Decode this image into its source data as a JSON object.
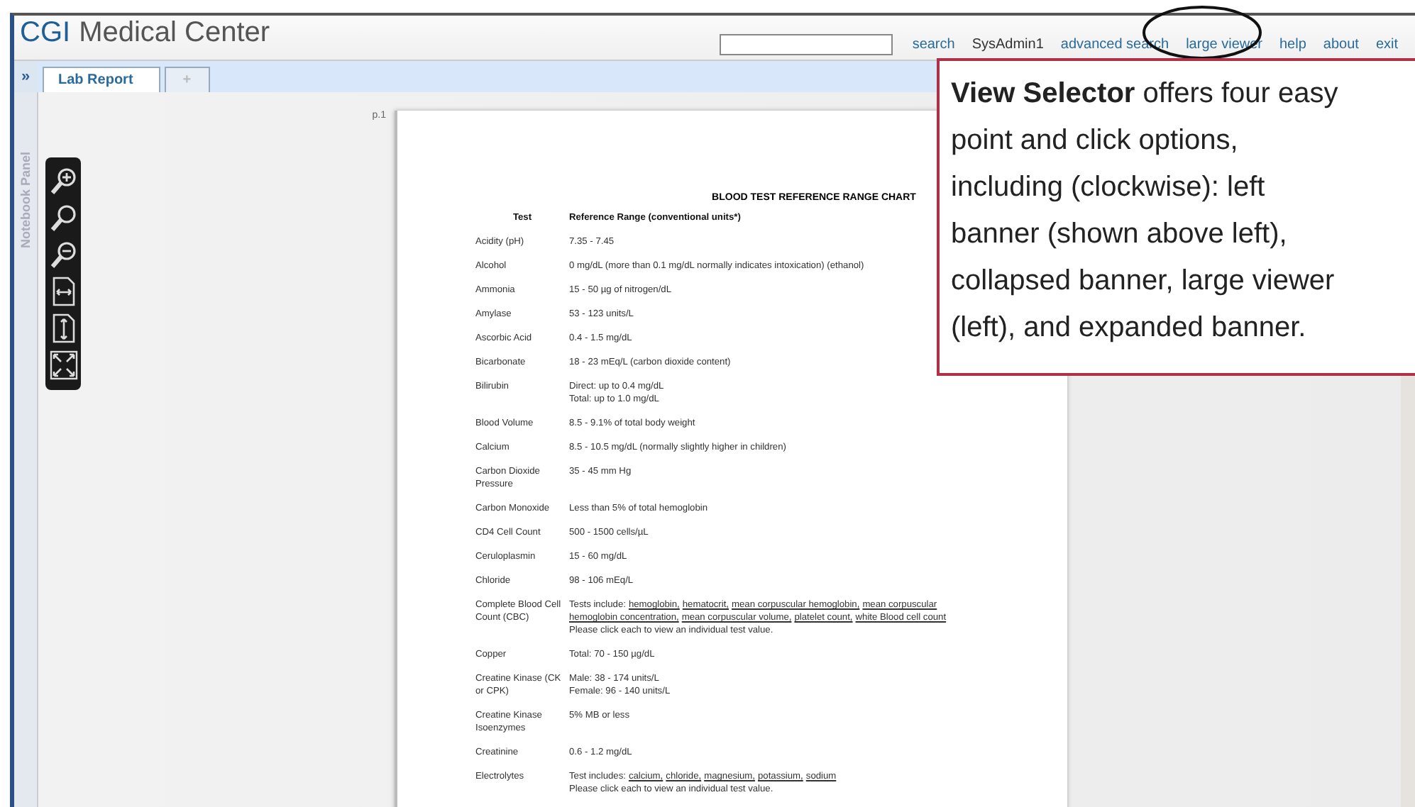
{
  "header": {
    "brand": "CGI",
    "title": "Medical Center",
    "links": [
      {
        "kind": "link",
        "label": "search"
      },
      {
        "kind": "user",
        "label": "SysAdmin1"
      },
      {
        "kind": "link",
        "label": "advanced search"
      },
      {
        "kind": "link",
        "label": "large viewer"
      },
      {
        "kind": "link",
        "label": "help"
      },
      {
        "kind": "link",
        "label": "about"
      },
      {
        "kind": "link",
        "label": "exit"
      }
    ]
  },
  "expand_button": "»",
  "tabs": [
    {
      "label": "Lab Report",
      "selected": true
    },
    {
      "label": "+",
      "selected": false
    }
  ],
  "notebook_panel": "Notebook Panel",
  "viewer": {
    "page_label": "p.1",
    "document": {
      "title": "BLOOD TEST REFERENCE RANGE CHART",
      "columns": [
        "Test",
        "Reference Range (conventional units*)"
      ],
      "rows": [
        {
          "test": "Acidity (pH)",
          "lines": [
            [
              {
                "text": "7.35 - 7.45",
                "kind": "text"
              }
            ]
          ]
        },
        {
          "test": "Alcohol",
          "lines": [
            [
              {
                "text": "0 mg/dL (more than 0.1 mg/dL normally indicates intoxication) (ethanol)",
                "kind": "text"
              }
            ]
          ]
        },
        {
          "test": "Ammonia",
          "lines": [
            [
              {
                "text": "15 - 50 µg of nitrogen/dL",
                "kind": "text"
              }
            ]
          ]
        },
        {
          "test": "Amylase",
          "lines": [
            [
              {
                "text": "53 - 123 units/L",
                "kind": "text"
              }
            ]
          ]
        },
        {
          "test": "Ascorbic Acid",
          "lines": [
            [
              {
                "text": "0.4 - 1.5 mg/dL",
                "kind": "text"
              }
            ]
          ]
        },
        {
          "test": "Bicarbonate",
          "lines": [
            [
              {
                "text": "18 - 23 mEq/L (carbon dioxide content)",
                "kind": "text"
              }
            ]
          ]
        },
        {
          "test": "Bilirubin",
          "lines": [
            [
              {
                "text": "Direct: up to 0.4 mg/dL",
                "kind": "text"
              }
            ],
            [
              {
                "text": "Total: up to 1.0 mg/dL",
                "kind": "text"
              }
            ]
          ]
        },
        {
          "test": "Blood Volume",
          "lines": [
            [
              {
                "text": "8.5 - 9.1% of total body weight",
                "kind": "text"
              }
            ]
          ]
        },
        {
          "test": "Calcium",
          "lines": [
            [
              {
                "text": "8.5 - 10.5 mg/dL (normally slightly higher in children)",
                "kind": "text"
              }
            ]
          ]
        },
        {
          "test": "Carbon Dioxide Pressure",
          "lines": [
            [
              {
                "text": "35 - 45 mm Hg",
                "kind": "text"
              }
            ]
          ]
        },
        {
          "test": "Carbon Monoxide",
          "lines": [
            [
              {
                "text": "Less than 5% of total hemoglobin",
                "kind": "text"
              }
            ]
          ]
        },
        {
          "test": "CD4 Cell Count",
          "lines": [
            [
              {
                "text": "500 - 1500 cells/µL",
                "kind": "text"
              }
            ]
          ]
        },
        {
          "test": "Ceruloplasmin",
          "lines": [
            [
              {
                "text": "15 - 60 mg/dL",
                "kind": "text"
              }
            ]
          ]
        },
        {
          "test": "Chloride",
          "lines": [
            [
              {
                "text": "98 - 106 mEq/L",
                "kind": "text"
              }
            ]
          ]
        },
        {
          "test": "Complete Blood Cell Count (CBC)",
          "lines": [
            [
              {
                "text": "Tests include:",
                "kind": "text"
              },
              {
                "text": "hemoglobin,",
                "kind": "link"
              },
              {
                "text": "hematocrit,",
                "kind": "link"
              },
              {
                "text": "mean corpuscular hemoglobin,",
                "kind": "link"
              },
              {
                "text": "mean corpuscular",
                "kind": "link"
              }
            ],
            [
              {
                "text": "hemoglobin concentration,",
                "kind": "link"
              },
              {
                "text": "mean corpuscular volume,",
                "kind": "link"
              },
              {
                "text": "platelet count,",
                "kind": "link"
              },
              {
                "text": "white Blood cell count",
                "kind": "link"
              }
            ],
            [
              {
                "text": "Please click each to view an individual test value.",
                "kind": "text"
              }
            ]
          ]
        },
        {
          "test": "Copper",
          "lines": [
            [
              {
                "text": "Total: 70 - 150 µg/dL",
                "kind": "text"
              }
            ]
          ]
        },
        {
          "test": "Creatine Kinase (CK or CPK)",
          "lines": [
            [
              {
                "text": "Male: 38 - 174 units/L",
                "kind": "text"
              }
            ],
            [
              {
                "text": "Female: 96 - 140 units/L",
                "kind": "text"
              }
            ]
          ]
        },
        {
          "test": "Creatine Kinase Isoenzymes",
          "lines": [
            [
              {
                "text": "5% MB or less",
                "kind": "text"
              }
            ]
          ]
        },
        {
          "test": "Creatinine",
          "lines": [
            [
              {
                "text": "0.6 - 1.2 mg/dL",
                "kind": "text"
              }
            ]
          ]
        },
        {
          "test": "Electrolytes",
          "lines": [
            [
              {
                "text": "Test includes:",
                "kind": "text"
              },
              {
                "text": "calcium,",
                "kind": "link"
              },
              {
                "text": "chloride,",
                "kind": "link"
              },
              {
                "text": "magnesium,",
                "kind": "link"
              },
              {
                "text": "potassium,",
                "kind": "link"
              },
              {
                "text": "sodium",
                "kind": "link"
              }
            ],
            [
              {
                "text": "Please click each to view an individual test value.",
                "kind": "text"
              }
            ]
          ]
        }
      ]
    }
  },
  "callout": {
    "lines": [
      "**View Selector** offers four easy",
      "point and click options,",
      "including (clockwise):  left",
      "banner (shown above left),",
      "collapsed banner, large viewer",
      "(left), and expanded banner."
    ]
  }
}
